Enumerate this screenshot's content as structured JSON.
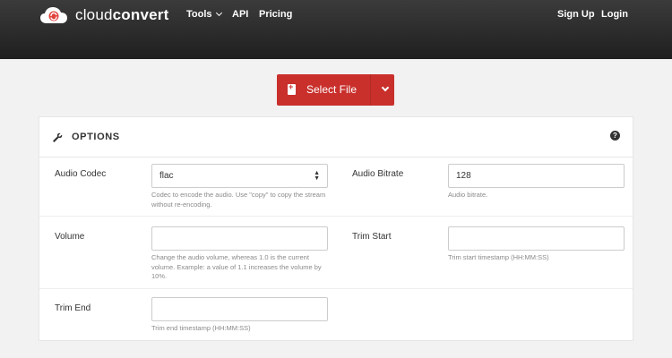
{
  "header": {
    "brand_light": "cloud",
    "brand_bold": "convert",
    "nav": {
      "tools": "Tools",
      "api": "API",
      "pricing": "Pricing",
      "signup": "Sign Up",
      "login": "Login"
    }
  },
  "select_file": {
    "label": "Select File"
  },
  "options": {
    "title": "OPTIONS",
    "help": "?",
    "fields": {
      "audio_codec": {
        "label": "Audio Codec",
        "value": "flac",
        "help": "Codec to encode the audio. Use \"copy\" to copy the stream without re-encoding."
      },
      "audio_bitrate": {
        "label": "Audio Bitrate",
        "value": "128",
        "help": "Audio bitrate."
      },
      "volume": {
        "label": "Volume",
        "value": "",
        "help": "Change the audio volume, whereas 1.0 is the current volume. Example: a value of 1.1 increases the volume by 10%."
      },
      "trim_start": {
        "label": "Trim Start",
        "value": "",
        "help": "Trim start timestamp (HH:MM:SS)"
      },
      "trim_end": {
        "label": "Trim End",
        "value": "",
        "help": "Trim end timestamp (HH:MM:SS)"
      }
    }
  },
  "colors": {
    "header_bg": "#2b2b2b",
    "accent_red": "#c9302c",
    "page_bg": "#f2f2f2"
  }
}
